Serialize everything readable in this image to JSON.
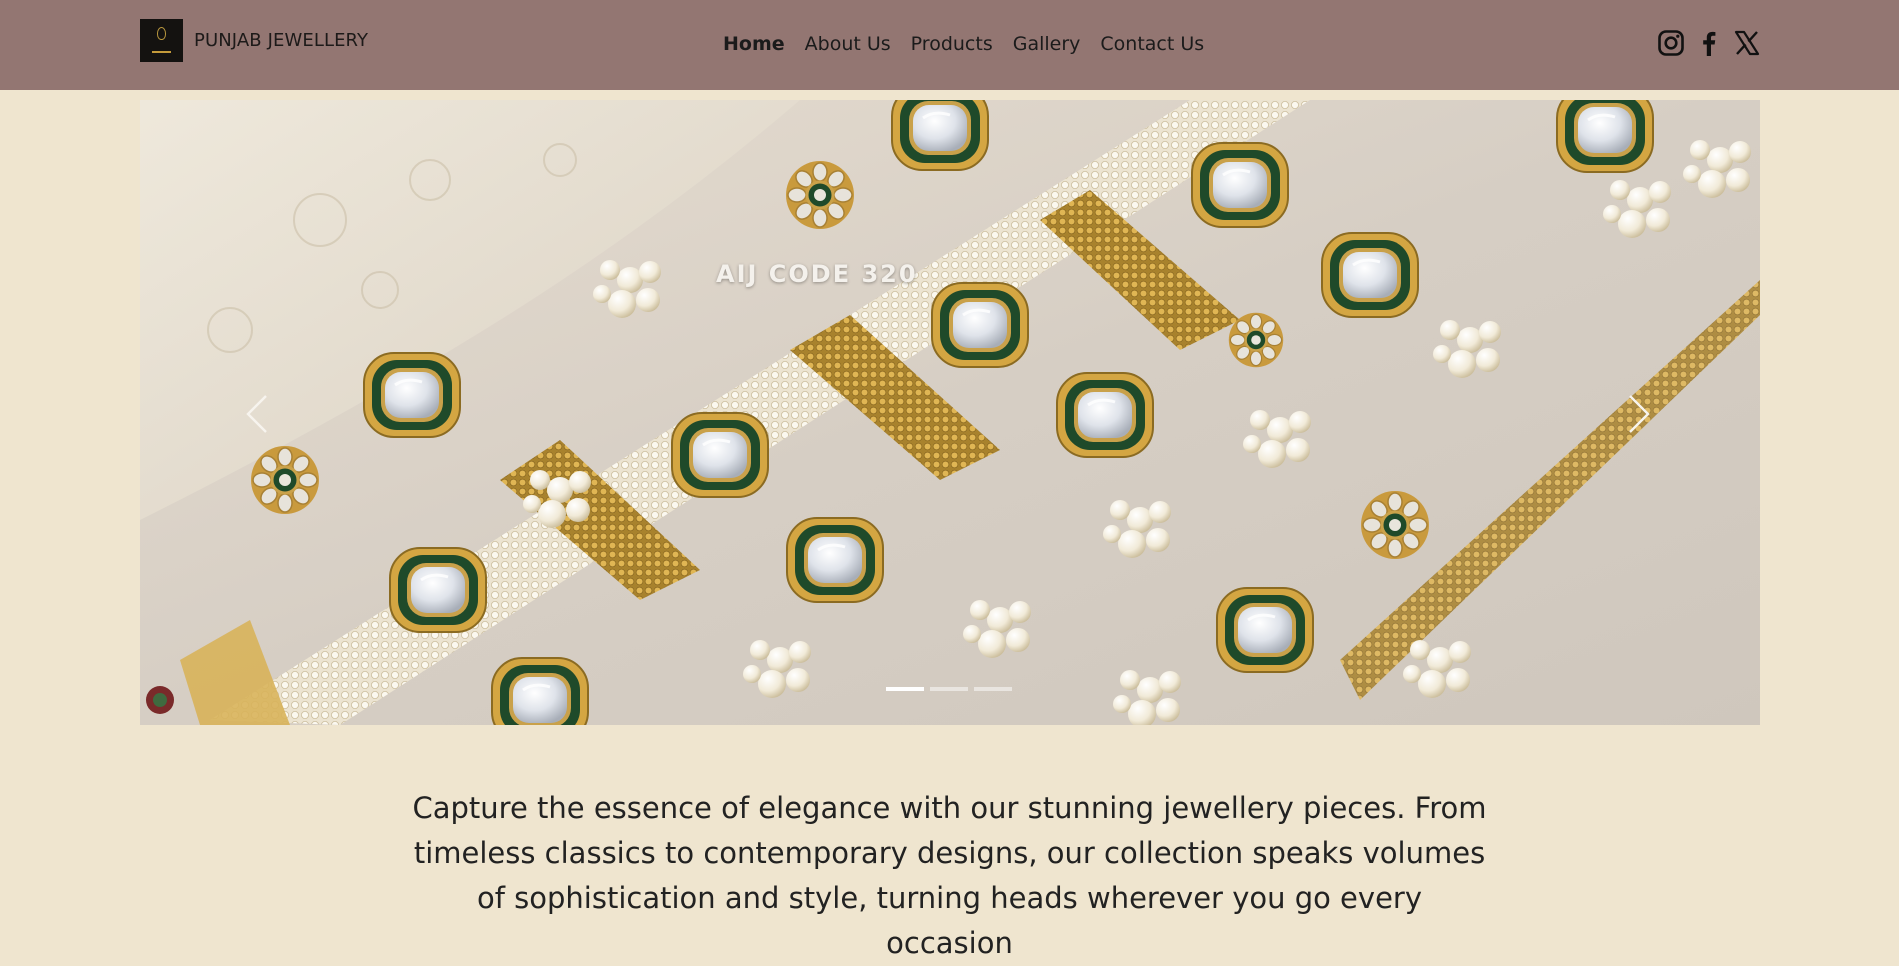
{
  "brand": {
    "name": "PUNJAB JEWELLERY"
  },
  "nav": {
    "items": [
      {
        "label": "Home",
        "active": true
      },
      {
        "label": "About Us",
        "active": false
      },
      {
        "label": "Products",
        "active": false
      },
      {
        "label": "Gallery",
        "active": false
      },
      {
        "label": "Contact Us",
        "active": false
      }
    ]
  },
  "social": [
    {
      "icon": "instagram-icon"
    },
    {
      "icon": "facebook-icon"
    },
    {
      "icon": "x-twitter-icon"
    }
  ],
  "carousel": {
    "slide_caption": "AIJ CODE 320",
    "slide_count": 3,
    "active_slide": 1,
    "prev_icon": "chevron-left-icon",
    "next_icon": "chevron-right-icon"
  },
  "intro": {
    "text": "Capture the essence of elegance with our stunning jewellery pieces. From timeless classics to contemporary designs, our collection speaks volumes of sophistication and style, turning heads wherever you go every occasion"
  },
  "colors": {
    "navbar": "#937672",
    "page_background": "#efe5cf",
    "text": "#1f1f1f",
    "gold": "#c49a3a",
    "kundan_green": "#1f4a2a"
  }
}
